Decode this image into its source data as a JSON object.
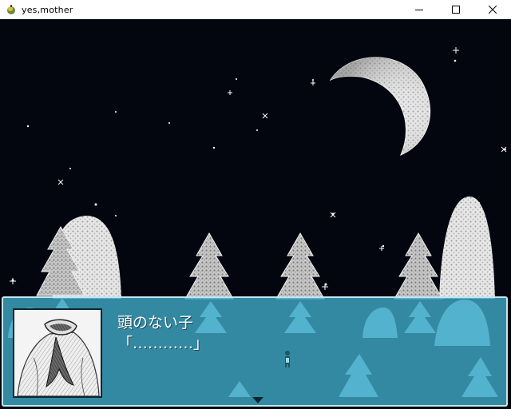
{
  "window": {
    "title": "yes,mother",
    "icon": "app-icon",
    "controls": [
      "minimize-icon",
      "maximize-icon",
      "close-icon"
    ]
  },
  "scene": {
    "sky_color": "#03060e",
    "moon_color": "#e8e8e8",
    "tree_color": "#dcdcdc"
  },
  "dialogue": {
    "speaker": "頭のない子",
    "line": "「…………」",
    "portrait": "headless-child-portrait",
    "box_color": "#40aac8",
    "border_color": "#c4e6ef"
  }
}
